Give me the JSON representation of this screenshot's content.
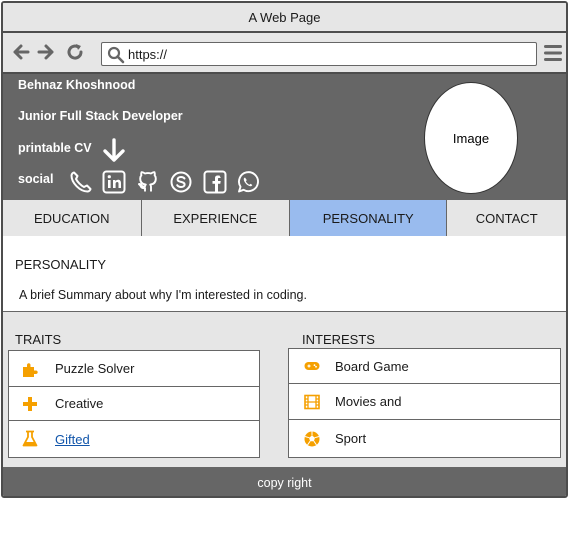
{
  "window": {
    "title": "A Web Page"
  },
  "browser": {
    "url": "https://"
  },
  "profile": {
    "name": "Behnaz Khoshnood",
    "role": "Junior Full Stack Developer",
    "cv_label": "printable CV",
    "social_label": "social",
    "photo_label": "Image"
  },
  "tabs": [
    {
      "label": "EDUCATION"
    },
    {
      "label": "EXPERIENCE"
    },
    {
      "label": "PERSONALITY"
    },
    {
      "label": "CONTACT"
    }
  ],
  "personality": {
    "title": "PERSONALITY",
    "summary": "A brief Summary about why I'm interested in coding.",
    "traits_title": "TRAITS",
    "traits": [
      {
        "label": "Puzzle Solver",
        "icon": "puzzle-icon"
      },
      {
        "label": "Creative",
        "icon": "plus-icon"
      },
      {
        "label": "Gifted",
        "icon": "flask-icon"
      }
    ],
    "interests_title": "INTERESTS",
    "interests": [
      {
        "label": "Board Game",
        "icon": "gamepad-icon"
      },
      {
        "label": "Movies and",
        "icon": "film-icon"
      },
      {
        "label": "Sport",
        "icon": "ball-icon"
      }
    ]
  },
  "footer": {
    "text": "copy right"
  },
  "colors": {
    "accent": "#f5a000",
    "active_tab": "#99bbee",
    "header_bg": "#666666",
    "chrome_bg": "#e6e6e6"
  }
}
